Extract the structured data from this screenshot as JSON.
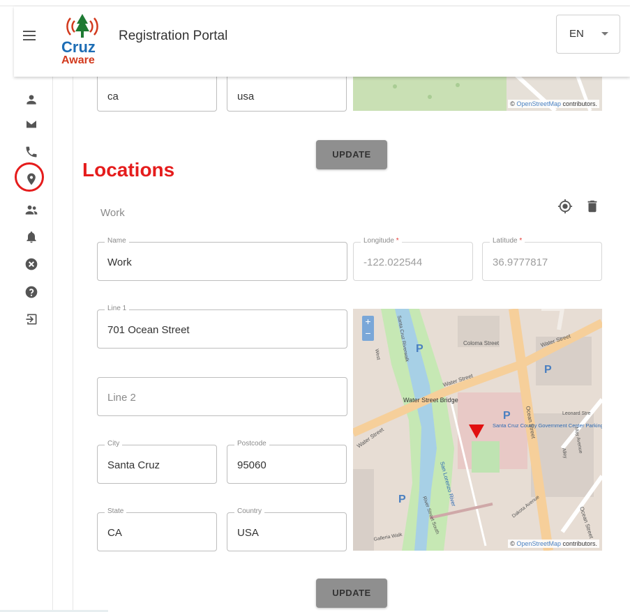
{
  "app": {
    "title": "Registration Portal",
    "logo_line1": "Cruz",
    "logo_line2": "Aware"
  },
  "header": {
    "language": "EN"
  },
  "sidebar": {
    "items": [
      {
        "icon": "person-icon"
      },
      {
        "icon": "email-icon"
      },
      {
        "icon": "phone-icon"
      },
      {
        "icon": "location-icon"
      },
      {
        "icon": "group-icon"
      },
      {
        "icon": "bell-icon"
      },
      {
        "icon": "cancel-icon"
      },
      {
        "icon": "help-icon"
      },
      {
        "icon": "logout-icon"
      }
    ]
  },
  "annotation": {
    "text": "Locations",
    "color": "#e51c1c"
  },
  "prev_location": {
    "state": "ca",
    "country": "usa",
    "update_label": "UPDATE"
  },
  "map": {
    "attribution_link": "OpenStreetMap",
    "attribution_suffix": " contributors.",
    "labels": [
      "Water Street",
      "Water Street",
      "Coloma Street",
      "Water Street",
      "Water Street Bridge",
      "Santa Cruz County Government Center Parking",
      "Ocean Street",
      "Leonard Stre",
      "Santa Cruz Riverwalk",
      "San Lorenzo River",
      "River Street South",
      "Galleria Walk",
      "Dakota Avenue",
      "May Avenue",
      "Alley",
      "Ocean Street",
      "West"
    ],
    "zoom_in": "+",
    "zoom_out": "−"
  },
  "location": {
    "title": "Work",
    "name_label": "Name",
    "name_value": "Work",
    "longitude_label": "Longitude",
    "longitude_value": "-122.022544",
    "latitude_label": "Latitude",
    "latitude_value": "36.9777817",
    "required_mark": "*",
    "line1_label": "Line 1",
    "line1_value": "701 Ocean Street",
    "line2_placeholder": "Line 2",
    "city_label": "City",
    "city_value": "Santa Cruz",
    "postcode_label": "Postcode",
    "postcode_value": "95060",
    "state_label": "State",
    "state_value": "CA",
    "country_label": "Country",
    "country_value": "USA",
    "update_label": "UPDATE"
  }
}
